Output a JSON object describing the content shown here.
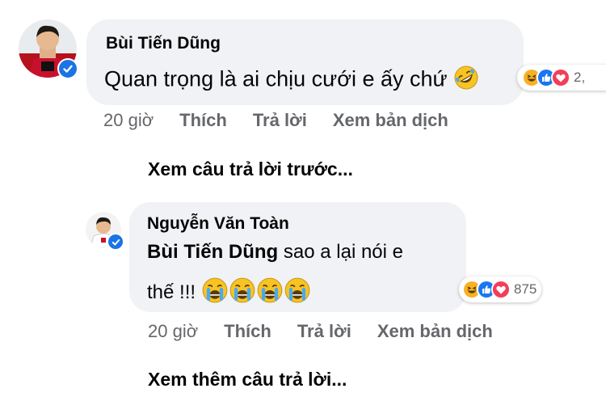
{
  "comments": [
    {
      "author": "Bùi Tiến Dũng",
      "text": "Quan trọng là ai chịu cưới e ấy chứ",
      "reaction_count": "2,",
      "time": "20 giờ",
      "like_label": "Thích",
      "reply_label": "Trả lời",
      "translate_label": "Xem bản dịch"
    },
    {
      "author": "Nguyễn Văn Toàn",
      "mention": "Bùi Tiến Dũng",
      "text_line1": " sao a lại nói e",
      "text_line2": "thế !!!",
      "reaction_count": "875",
      "time": "20 giờ",
      "like_label": "Thích",
      "reply_label": "Trả lời",
      "translate_label": "Xem bản dịch"
    }
  ],
  "links": {
    "previous_replies": "Xem câu trả lời trước...",
    "more_replies": "Xem thêm câu trả lời..."
  },
  "colors": {
    "bubble": "#f0f2f5",
    "meta_text": "#65676b",
    "like_blue": "#1877f2",
    "love_red": "#f33e58",
    "haha_yellow": "#f7b125"
  },
  "icons": {
    "verified": "verified-badge-icon",
    "rofl": "rolling-laughing-emoji",
    "crying": "loudly-crying-emoji",
    "haha": "haha-reaction-icon",
    "like": "like-reaction-icon",
    "love": "love-reaction-icon"
  }
}
